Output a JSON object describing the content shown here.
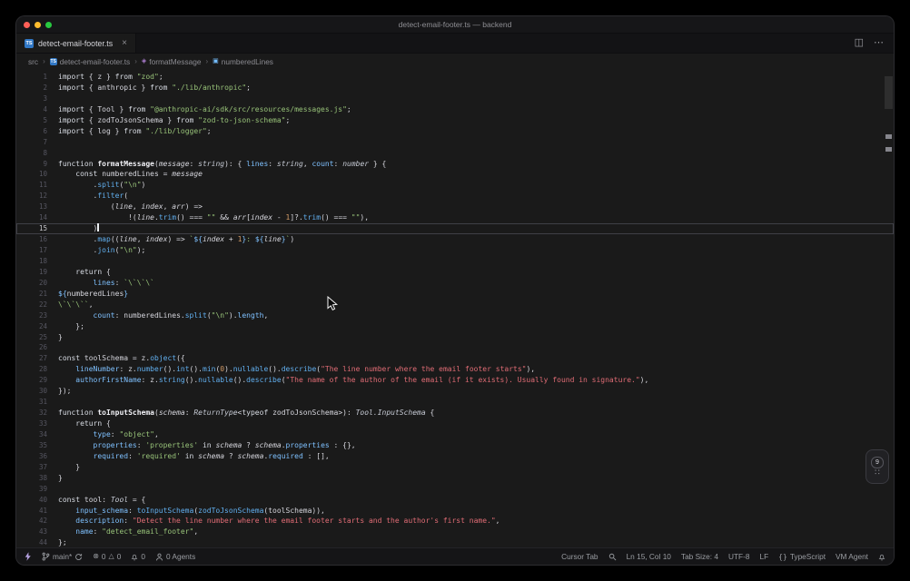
{
  "window": {
    "title": "detect-email-footer.ts — backend"
  },
  "tab_bar": {
    "active_tab": {
      "file_icon": "TS",
      "label": "detect-email-footer.ts",
      "close": "×"
    },
    "actions": {
      "split": "◫",
      "more": "⋯"
    }
  },
  "breadcrumbs": {
    "separator": "›",
    "items": [
      {
        "label": "src"
      },
      {
        "label": "detect-email-footer.ts",
        "icon_text": "TS"
      },
      {
        "label": "formatMessage",
        "glyph": "◈"
      },
      {
        "label": "numberedLines",
        "glyph": "▣"
      }
    ]
  },
  "palette": {
    "background": "#1a1a1a",
    "titlebar": "#161618",
    "tabbar": "#131315",
    "statusbar": "#151517",
    "text": "#d6d6dd",
    "string-green": "#98c379",
    "string-red": "#e06c75",
    "property-blue": "#7fc1ff",
    "call-blue": "#61afef",
    "number-amber": "#d19a66",
    "ts-badge-blue": "#3178c6",
    "method-purple": "#b180d7",
    "variable-blue": "#75beff",
    "traffic-red": "#ff5f57",
    "traffic-yellow": "#febc2e",
    "traffic-green": "#28c840"
  },
  "editor": {
    "active_line": 15,
    "lines": [
      [
        [
          "import",
          "kw"
        ],
        [
          " { ",
          "p"
        ],
        [
          "z",
          "p"
        ],
        [
          " } ",
          "p"
        ],
        [
          "from",
          "kw"
        ],
        [
          " ",
          "p"
        ],
        [
          "\"zod\"",
          "s"
        ],
        [
          ";",
          "p"
        ]
      ],
      [
        [
          "import",
          "kw"
        ],
        [
          " { ",
          "p"
        ],
        [
          "anthropic",
          "p"
        ],
        [
          " } ",
          "p"
        ],
        [
          "from",
          "kw"
        ],
        [
          " ",
          "p"
        ],
        [
          "\"./lib/anthropic\"",
          "s"
        ],
        [
          ";",
          "p"
        ]
      ],
      [],
      [
        [
          "import",
          "kw"
        ],
        [
          " { ",
          "p"
        ],
        [
          "Tool",
          "p"
        ],
        [
          " } ",
          "p"
        ],
        [
          "from",
          "kw"
        ],
        [
          " ",
          "p"
        ],
        [
          "\"@anthropic-ai/sdk/src/resources/messages.js\"",
          "s"
        ],
        [
          ";",
          "p"
        ]
      ],
      [
        [
          "import",
          "kw"
        ],
        [
          " { ",
          "p"
        ],
        [
          "zodToJsonSchema",
          "p"
        ],
        [
          " } ",
          "p"
        ],
        [
          "from",
          "kw"
        ],
        [
          " ",
          "p"
        ],
        [
          "\"zod-to-json-schema\"",
          "s"
        ],
        [
          ";",
          "p"
        ]
      ],
      [
        [
          "import",
          "kw"
        ],
        [
          " { ",
          "p"
        ],
        [
          "log",
          "p"
        ],
        [
          " } ",
          "p"
        ],
        [
          "from",
          "kw"
        ],
        [
          " ",
          "p"
        ],
        [
          "\"./lib/logger\"",
          "s"
        ],
        [
          ";",
          "p"
        ]
      ],
      [],
      [],
      [
        [
          "function",
          "kw"
        ],
        [
          " ",
          "p"
        ],
        [
          "formatMessage",
          "f"
        ],
        [
          "(",
          "p"
        ],
        [
          "message",
          "i"
        ],
        [
          ": ",
          "p"
        ],
        [
          "string",
          "t"
        ],
        [
          "): { ",
          "p"
        ],
        [
          "lines",
          "b"
        ],
        [
          ": ",
          "p"
        ],
        [
          "string",
          "t"
        ],
        [
          ", ",
          "p"
        ],
        [
          "count",
          "b"
        ],
        [
          ": ",
          "p"
        ],
        [
          "number",
          "t"
        ],
        [
          " } {",
          "p"
        ]
      ],
      [
        [
          "    ",
          "p"
        ],
        [
          "const",
          "kw"
        ],
        [
          " ",
          "p"
        ],
        [
          "numberedLines",
          "p"
        ],
        [
          " = ",
          "p"
        ],
        [
          "message",
          "i"
        ]
      ],
      [
        [
          "        .",
          "p"
        ],
        [
          "split",
          "c"
        ],
        [
          "(",
          "p"
        ],
        [
          "\"\\n\"",
          "s"
        ],
        [
          ")",
          "p"
        ]
      ],
      [
        [
          "        .",
          "p"
        ],
        [
          "filter",
          "c"
        ],
        [
          "(",
          "p"
        ]
      ],
      [
        [
          "            (",
          "p"
        ],
        [
          "line",
          "i"
        ],
        [
          ", ",
          "p"
        ],
        [
          "index",
          "i"
        ],
        [
          ", ",
          "p"
        ],
        [
          "arr",
          "i"
        ],
        [
          ") =>",
          "p"
        ]
      ],
      [
        [
          "                !(",
          "p"
        ],
        [
          "line",
          "i"
        ],
        [
          ".",
          "p"
        ],
        [
          "trim",
          "c"
        ],
        [
          "() === ",
          "p"
        ],
        [
          "\"\"",
          "s"
        ],
        [
          " && ",
          "p"
        ],
        [
          "arr",
          "i"
        ],
        [
          "[",
          "p"
        ],
        [
          "index",
          "i"
        ],
        [
          " - ",
          "p"
        ],
        [
          "1",
          "n"
        ],
        [
          "]?.",
          "p"
        ],
        [
          "trim",
          "c"
        ],
        [
          "() === ",
          "p"
        ],
        [
          "\"\"",
          "s"
        ],
        [
          "),",
          "p"
        ]
      ],
      [
        [
          "        )",
          "p"
        ]
      ],
      [
        [
          "        .",
          "p"
        ],
        [
          "map",
          "c"
        ],
        [
          "((",
          "p"
        ],
        [
          "line",
          "i"
        ],
        [
          ", ",
          "p"
        ],
        [
          "index",
          "i"
        ],
        [
          ") => ",
          "p"
        ],
        [
          "`",
          "s"
        ],
        [
          "${",
          "b"
        ],
        [
          "index",
          "i"
        ],
        [
          " + ",
          "p"
        ],
        [
          "1",
          "n"
        ],
        [
          "}",
          "b"
        ],
        [
          ": ",
          "s"
        ],
        [
          "${",
          "b"
        ],
        [
          "line",
          "i"
        ],
        [
          "}",
          "b"
        ],
        [
          "`",
          "s"
        ],
        [
          ")",
          "p"
        ]
      ],
      [
        [
          "        .",
          "p"
        ],
        [
          "join",
          "c"
        ],
        [
          "(",
          "p"
        ],
        [
          "\"\\n\"",
          "s"
        ],
        [
          ");",
          "p"
        ]
      ],
      [],
      [
        [
          "    ",
          "p"
        ],
        [
          "return",
          "kw"
        ],
        [
          " {",
          "p"
        ]
      ],
      [
        [
          "        ",
          "p"
        ],
        [
          "lines",
          "b"
        ],
        [
          ": ",
          "p"
        ],
        [
          "`\\`\\`\\`",
          "s"
        ]
      ],
      [
        [
          "${",
          "b"
        ],
        [
          "numberedLines",
          "p"
        ],
        [
          "}",
          "b"
        ]
      ],
      [
        [
          "\\`\\`\\``",
          "s"
        ],
        [
          ",",
          "p"
        ]
      ],
      [
        [
          "        ",
          "p"
        ],
        [
          "count",
          "b"
        ],
        [
          ": ",
          "p"
        ],
        [
          "numberedLines",
          "p"
        ],
        [
          ".",
          "p"
        ],
        [
          "split",
          "c"
        ],
        [
          "(",
          "p"
        ],
        [
          "\"\\n\"",
          "s"
        ],
        [
          ").",
          "p"
        ],
        [
          "length",
          "b"
        ],
        [
          ",",
          "p"
        ]
      ],
      [
        [
          "    };",
          "p"
        ]
      ],
      [
        [
          "}",
          "p"
        ]
      ],
      [],
      [
        [
          "const",
          "kw"
        ],
        [
          " ",
          "p"
        ],
        [
          "toolSchema",
          "p"
        ],
        [
          " = ",
          "p"
        ],
        [
          "z",
          "p"
        ],
        [
          ".",
          "p"
        ],
        [
          "object",
          "c"
        ],
        [
          "({",
          "p"
        ]
      ],
      [
        [
          "    ",
          "p"
        ],
        [
          "lineNumber",
          "b"
        ],
        [
          ": ",
          "p"
        ],
        [
          "z",
          "p"
        ],
        [
          ".",
          "p"
        ],
        [
          "number",
          "c"
        ],
        [
          "().",
          "p"
        ],
        [
          "int",
          "c"
        ],
        [
          "().",
          "p"
        ],
        [
          "min",
          "c"
        ],
        [
          "(",
          "p"
        ],
        [
          "0",
          "n"
        ],
        [
          ").",
          "p"
        ],
        [
          "nullable",
          "c"
        ],
        [
          "().",
          "p"
        ],
        [
          "describe",
          "c"
        ],
        [
          "(",
          "p"
        ],
        [
          "\"The line number where the email footer starts\"",
          "r"
        ],
        [
          "),",
          "p"
        ]
      ],
      [
        [
          "    ",
          "p"
        ],
        [
          "authorFirstName",
          "b"
        ],
        [
          ": ",
          "p"
        ],
        [
          "z",
          "p"
        ],
        [
          ".",
          "p"
        ],
        [
          "string",
          "c"
        ],
        [
          "().",
          "p"
        ],
        [
          "nullable",
          "c"
        ],
        [
          "().",
          "p"
        ],
        [
          "describe",
          "c"
        ],
        [
          "(",
          "p"
        ],
        [
          "\"The name of the author of the email (if it exists). Usually found in signature.\"",
          "r"
        ],
        [
          "),",
          "p"
        ]
      ],
      [
        [
          "});",
          "p"
        ]
      ],
      [],
      [
        [
          "function",
          "kw"
        ],
        [
          " ",
          "p"
        ],
        [
          "toInputSchema",
          "f"
        ],
        [
          "(",
          "p"
        ],
        [
          "schema",
          "i"
        ],
        [
          ": ",
          "p"
        ],
        [
          "ReturnType",
          "t"
        ],
        [
          "<",
          "p"
        ],
        [
          "typeof",
          "kw"
        ],
        [
          " ",
          "p"
        ],
        [
          "zodToJsonSchema",
          "p"
        ],
        [
          ">): ",
          "p"
        ],
        [
          "Tool.InputSchema",
          "t"
        ],
        [
          " {",
          "p"
        ]
      ],
      [
        [
          "    ",
          "p"
        ],
        [
          "return",
          "kw"
        ],
        [
          " {",
          "p"
        ]
      ],
      [
        [
          "        ",
          "p"
        ],
        [
          "type",
          "b"
        ],
        [
          ": ",
          "p"
        ],
        [
          "\"object\"",
          "s"
        ],
        [
          ",",
          "p"
        ]
      ],
      [
        [
          "        ",
          "p"
        ],
        [
          "properties",
          "b"
        ],
        [
          ": ",
          "p"
        ],
        [
          "'properties'",
          "s"
        ],
        [
          " ",
          "p"
        ],
        [
          "in",
          "kw"
        ],
        [
          " ",
          "p"
        ],
        [
          "schema",
          "i"
        ],
        [
          " ? ",
          "p"
        ],
        [
          "schema",
          "i"
        ],
        [
          ".",
          "p"
        ],
        [
          "properties",
          "b"
        ],
        [
          " : {},",
          "p"
        ]
      ],
      [
        [
          "        ",
          "p"
        ],
        [
          "required",
          "b"
        ],
        [
          ": ",
          "p"
        ],
        [
          "'required'",
          "s"
        ],
        [
          " ",
          "p"
        ],
        [
          "in",
          "kw"
        ],
        [
          " ",
          "p"
        ],
        [
          "schema",
          "i"
        ],
        [
          " ? ",
          "p"
        ],
        [
          "schema",
          "i"
        ],
        [
          ".",
          "p"
        ],
        [
          "required",
          "b"
        ],
        [
          " : [],",
          "p"
        ]
      ],
      [
        [
          "    }",
          "p"
        ]
      ],
      [
        [
          "}",
          "p"
        ]
      ],
      [],
      [
        [
          "const",
          "kw"
        ],
        [
          " ",
          "p"
        ],
        [
          "tool",
          "p"
        ],
        [
          ": ",
          "p"
        ],
        [
          "Tool",
          "t"
        ],
        [
          " = {",
          "p"
        ]
      ],
      [
        [
          "    ",
          "p"
        ],
        [
          "input_schema",
          "b"
        ],
        [
          ": ",
          "p"
        ],
        [
          "toInputSchema",
          "c"
        ],
        [
          "(",
          "p"
        ],
        [
          "zodToJsonSchema",
          "c"
        ],
        [
          "(",
          "p"
        ],
        [
          "toolSchema",
          "p"
        ],
        [
          ")),",
          "p"
        ]
      ],
      [
        [
          "    ",
          "p"
        ],
        [
          "description",
          "b"
        ],
        [
          ": ",
          "p"
        ],
        [
          "\"Detect the line number where the email footer starts and the author's first name.\"",
          "r"
        ],
        [
          ",",
          "p"
        ]
      ],
      [
        [
          "    ",
          "p"
        ],
        [
          "name",
          "b"
        ],
        [
          ": ",
          "p"
        ],
        [
          "\"detect_email_footer\"",
          "s"
        ],
        [
          ",",
          "p"
        ]
      ],
      [
        [
          "};",
          "p"
        ]
      ]
    ]
  },
  "floating_widget": {
    "badge": "9",
    "grid_glyph": "∷"
  },
  "status_bar": {
    "branch": "main*",
    "error_icon": "⊗",
    "errors": "0",
    "warning_icon": "△",
    "warnings": "0",
    "notifications": "0",
    "agents": "0 Agents",
    "cursor_tab": "Cursor Tab",
    "position": "Ln 15, Col 10",
    "tab_size": "Tab Size: 4",
    "encoding": "UTF-8",
    "eol": "LF",
    "language_icon": "{}",
    "language": "TypeScript",
    "vm": "VM Agent"
  }
}
